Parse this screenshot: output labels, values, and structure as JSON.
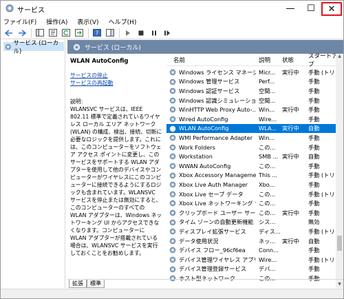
{
  "window": {
    "title": "サービス",
    "min_glyph": "—",
    "max_glyph": "☐",
    "close_glyph": "✕"
  },
  "menu": [
    "ファイル(F)",
    "操作(A)",
    "表示(V)",
    "ヘルプ(H)"
  ],
  "tree": {
    "item": "サービス (ローカル)"
  },
  "header": {
    "title": "サービス (ローカル)"
  },
  "detail": {
    "service_name": "WLAN AutoConfig",
    "stop_link": "サービスの停止",
    "restart_link": "サービスの再起動",
    "desc_label": "説明:",
    "desc_text": "WLANSVC サービスは、IEEE 802.11 標準で定義されているワイヤレス ローカル エリア ネットワーク (WLAN) の構成、検出、接続、切断に必要なロジックを提供します。これには、このコンピューターをソフトウェア アクセス ポイントに変更し、このサービスをサポートする WLAN アダプターを使用して他のデバイスやコンピューターがワイヤレスにこのコンピューターに接続できるようにするロジックも含まれています。WLANSVC サービスを停止または無効にすると、このコンピューターのすべての WLAN アダプターは、Windows ネットワーキング UI からアクセスできなくなります。コンピューターに WLAN アダプターが搭載されている場合は、WLANSVC サービスを実行しておくことをお勧めします。"
  },
  "columns": {
    "name": "名前",
    "desc": "説明",
    "state": "状態",
    "start": "スタートアップ"
  },
  "rows": [
    {
      "name": "Windows ライセンス マネージャ...",
      "desc": "Micr...",
      "state": "実行中",
      "start": "手動 (トリ"
    },
    {
      "name": "Windows 管理サービス",
      "desc": "Perf...",
      "state": "",
      "start": "手動"
    },
    {
      "name": "Windows 認証サービス",
      "desc": "空間...",
      "state": "",
      "start": "手動"
    },
    {
      "name": "Windows 認識シミュレーション ...",
      "desc": "空間...",
      "state": "",
      "start": "手動"
    },
    {
      "name": "WinHTTP Web Proxy Auto-...",
      "desc": "Win...",
      "state": "実行中",
      "start": "手動"
    },
    {
      "name": "Wired AutoConfig",
      "desc": "Wire...",
      "state": "",
      "start": "手動"
    },
    {
      "name": "WLAN AutoConfig",
      "desc": "WLA...",
      "state": "実行中",
      "start": "自動",
      "selected": true
    },
    {
      "name": "WMI Performance Adapter",
      "desc": "Win...",
      "state": "",
      "start": "手動"
    },
    {
      "name": "Work Folders",
      "desc": "この...",
      "state": "",
      "start": "手動"
    },
    {
      "name": "Workstation",
      "desc": "SMB ...",
      "state": "実行中",
      "start": "自動"
    },
    {
      "name": "WWAN AutoConfig",
      "desc": "この...",
      "state": "",
      "start": "手動"
    },
    {
      "name": "Xbox Accessory Manageme...",
      "desc": "This ...",
      "state": "",
      "start": "手動 (トリ"
    },
    {
      "name": "Xbox Live Auth Manager",
      "desc": "Xbo...",
      "state": "",
      "start": "手動"
    },
    {
      "name": "Xbox Live セーブ データ",
      "desc": "この...",
      "state": "",
      "start": "手動 (トリ"
    },
    {
      "name": "Xbox Live ネットワーキング サー...",
      "desc": "この...",
      "state": "",
      "start": "手動"
    },
    {
      "name": "クリップボード ユーザー サービス...",
      "desc": "この...",
      "state": "実行中",
      "start": "手動"
    },
    {
      "name": "タイム ゾーンの自動更新機能",
      "desc": "シス...",
      "state": "",
      "start": "無効"
    },
    {
      "name": "ディスプレイ拡張サービス",
      "desc": "ディス...",
      "state": "",
      "start": "手動 (トリ"
    },
    {
      "name": "データ使用状況",
      "desc": "ネッ...",
      "state": "実行中",
      "start": "自動"
    },
    {
      "name": "デバイス フロー_96cf6ea",
      "desc": "Conn...",
      "state": "",
      "start": "手動"
    },
    {
      "name": "デバイス管理ワイヤレス アプリケ...",
      "desc": "Wire...",
      "state": "",
      "start": "手動 (トリ"
    },
    {
      "name": "デバイス管理登録サービス",
      "desc": "デバ...",
      "state": "",
      "start": "手動"
    },
    {
      "name": "ホスト型ネットワーク",
      "desc": "この...",
      "state": "",
      "start": "手動"
    }
  ],
  "tabs": [
    "拡張",
    "標準"
  ]
}
